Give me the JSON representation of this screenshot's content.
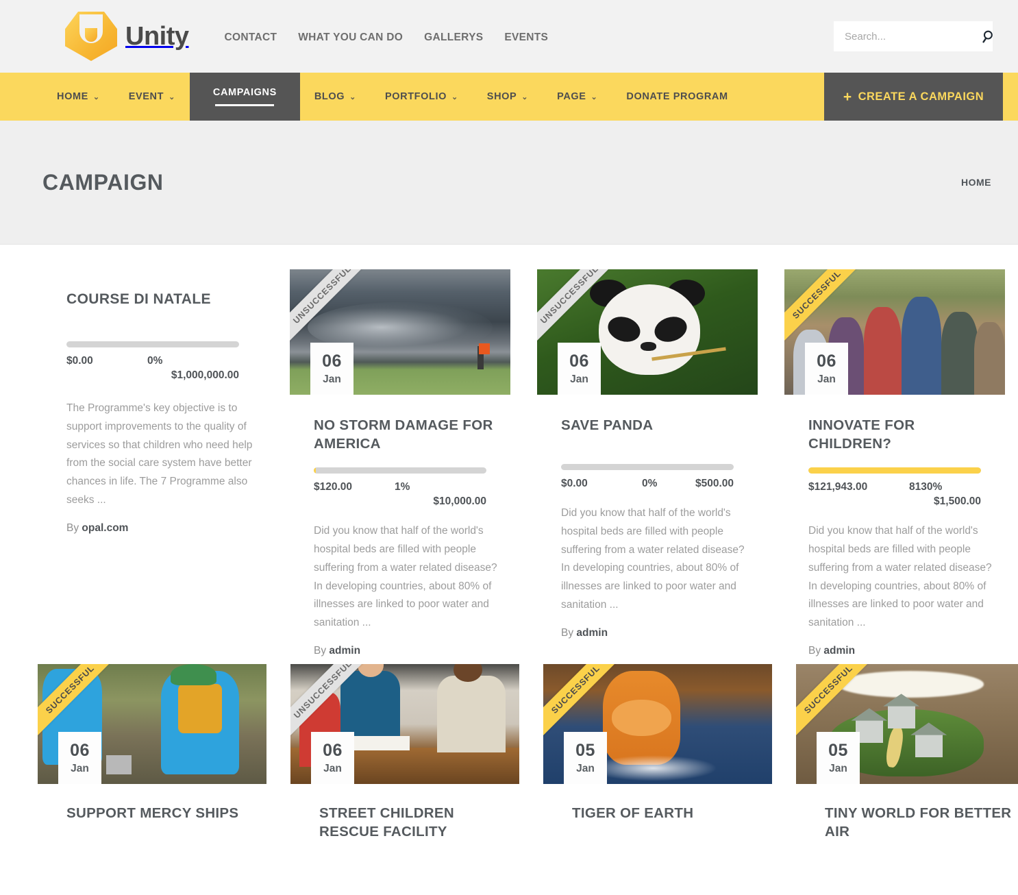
{
  "brand": {
    "name": "Unity",
    "logo_icon": "unity-hex-logo"
  },
  "topnav": {
    "items": [
      {
        "label": "CONTACT"
      },
      {
        "label": "WHAT YOU CAN DO"
      },
      {
        "label": "GALLERYS"
      },
      {
        "label": "EVENTS"
      }
    ]
  },
  "search": {
    "placeholder": "Search...",
    "value": "",
    "icon": "search-icon"
  },
  "mainnav": {
    "items": [
      {
        "label": "HOME",
        "caret": "⌄",
        "active": false
      },
      {
        "label": "EVENT",
        "caret": "⌄",
        "active": false
      },
      {
        "label": "CAMPAIGNS",
        "caret": "",
        "active": true
      },
      {
        "label": "BLOG",
        "caret": "⌄",
        "active": false
      },
      {
        "label": "PORTFOLIO",
        "caret": "⌄",
        "active": false
      },
      {
        "label": "SHOP",
        "caret": "⌄",
        "active": false
      },
      {
        "label": "PAGE",
        "caret": "⌄",
        "active": false
      },
      {
        "label": "DONATE PROGRAM",
        "caret": "",
        "active": false
      }
    ],
    "cta": {
      "label": "CREATE A CAMPAIGN",
      "plus": "+"
    }
  },
  "page_header": {
    "title": "CAMPAIGN",
    "breadcrumb": "HOME"
  },
  "colors": {
    "accent_yellow": "#fbd85d",
    "progress_yellow": "#fbd14a",
    "dark_gray": "#555555",
    "text_gray": "#555a5e",
    "muted_text": "#9c9c9c",
    "page_bg": "#ffffff",
    "header_bg": "#f2f2f2",
    "titlebar_bg": "#efefef",
    "ribbon_gray": "#e2e2e2"
  },
  "intro_campaign": {
    "title": "COURSE DI NATALE",
    "raised": "$0.00",
    "percent": "0%",
    "goal": "$1,000,000.00",
    "percent_value": 0,
    "excerpt": "The Programme's key objective is to support improvements to the quality of services so that children who need help from the social care system have better chances in life. The 7 Programme also seeks ...",
    "by_prefix": "By ",
    "author": "opal.com"
  },
  "campaigns_row1": [
    {
      "ribbon": "UNSUCCESSFUL",
      "ribbon_state": "unsuccessful",
      "day": "06",
      "month": "Jan",
      "title": "NO STORM DAMAGE FOR AMERICA",
      "raised": "$120.00",
      "percent": "1%",
      "goal": "$10,000.00",
      "percent_value": 1,
      "two_line_amounts": true,
      "excerpt": "Did you know that half of the world's hospital beds are filled with people suffering from a water related disease? In developing countries, about 80% of illnesses are linked to poor water and sanitation ...",
      "by_prefix": "By ",
      "author": "admin",
      "photo": "ph-storm"
    },
    {
      "ribbon": "UNSUCCESSFUL",
      "ribbon_state": "unsuccessful",
      "day": "06",
      "month": "Jan",
      "title": "SAVE PANDA",
      "raised": "$0.00",
      "percent": "0%",
      "goal": "$500.00",
      "percent_value": 0,
      "two_line_amounts": false,
      "excerpt": "Did you know that half of the world's hospital beds are filled with people suffering from a water related disease? In developing countries, about 80% of illnesses are linked to poor water and sanitation ...",
      "by_prefix": "By ",
      "author": "admin",
      "photo": "ph-panda"
    },
    {
      "ribbon": "SUCCESSFUL",
      "ribbon_state": "successful",
      "day": "06",
      "month": "Jan",
      "title": "INNOVATE FOR CHILDREN?",
      "raised": "$121,943.00",
      "percent": "8130%",
      "goal": "$1,500.00",
      "percent_value": 100,
      "two_line_amounts": true,
      "excerpt": "Did you know that half of the world's hospital beds are filled with people suffering from a water related disease? In developing countries, about 80% of illnesses are linked to poor water and sanitation ...",
      "by_prefix": "By ",
      "author": "admin",
      "photo": "ph-kids"
    }
  ],
  "campaigns_row2": [
    {
      "ribbon": "SUCCESSFUL",
      "ribbon_state": "successful",
      "day": "06",
      "month": "Jan",
      "title": "SUPPORT MERCY SHIPS",
      "photo": "ph-garden"
    },
    {
      "ribbon": "UNSUCCESSFUL",
      "ribbon_state": "unsuccessful",
      "day": "06",
      "month": "Jan",
      "title": "STREET CHILDREN RESCUE FACILITY",
      "photo": "ph-office"
    },
    {
      "ribbon": "SUCCESSFUL",
      "ribbon_state": "successful",
      "day": "05",
      "month": "Jan",
      "title": "TIGER OF EARTH",
      "photo": "ph-tiger"
    },
    {
      "ribbon": "SUCCESSFUL",
      "ribbon_state": "successful",
      "day": "05",
      "month": "Jan",
      "title": "TINY WORLD FOR BETTER AIR",
      "photo": "ph-tiny"
    }
  ]
}
